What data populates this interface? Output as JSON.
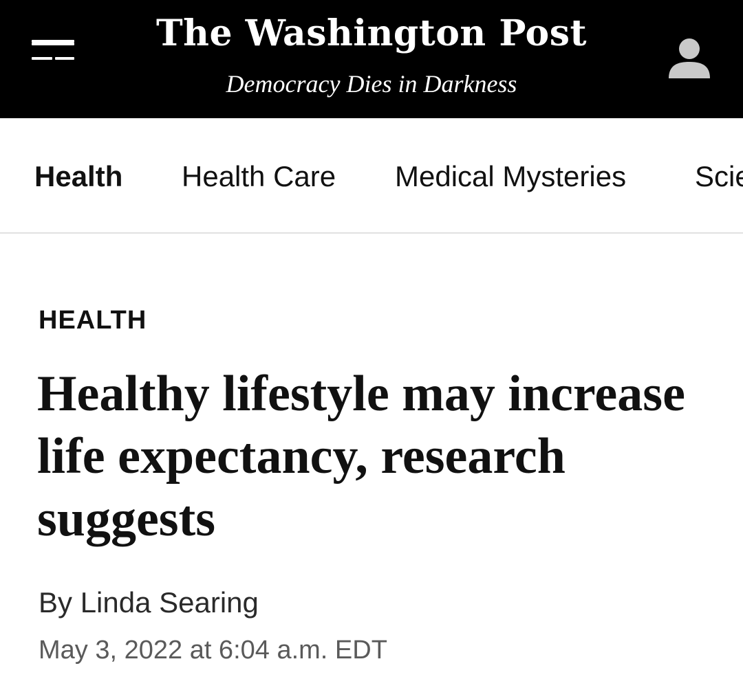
{
  "masthead": {
    "logo": "The Washington Post",
    "tagline": "Democracy Dies in Darkness",
    "menu_icon": "hamburger-menu-icon",
    "account_icon": "user-account-icon"
  },
  "nav": {
    "items": [
      {
        "label": "Health",
        "active": true
      },
      {
        "label": "Health Care",
        "active": false
      },
      {
        "label": "Medical Mysteries",
        "active": false
      },
      {
        "label": "Science",
        "active": false
      }
    ]
  },
  "article": {
    "kicker": "HEALTH",
    "headline": "Healthy lifestyle may increase life expectancy, research suggests",
    "byline_prefix": "By ",
    "author": "Linda Searing",
    "timestamp": "May 3, 2022 at 6:04 a.m. EDT"
  },
  "colors": {
    "masthead_bg": "#000000",
    "text": "#111111",
    "timestamp": "#5a5a5a"
  }
}
